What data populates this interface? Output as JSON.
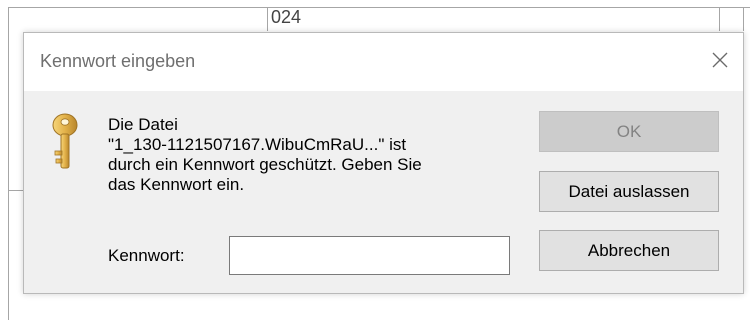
{
  "background_window": {
    "partial_text": "024"
  },
  "dialog": {
    "title": "Kennwort eingeben",
    "icon": "key-icon",
    "close_icon": "close-icon",
    "message_lines": [
      "Die Datei",
      "\"1_130-1121507167.WibuCmRaU...\" ist",
      "durch ein Kennwort geschützt. Geben Sie",
      "das Kennwort ein."
    ],
    "password_label": "Kennwort:",
    "password_value": "",
    "password_placeholder": "",
    "buttons": {
      "ok": {
        "label": "OK",
        "enabled": false
      },
      "skip": {
        "label": "Datei auslassen",
        "enabled": true
      },
      "cancel": {
        "label": "Abbrechen",
        "enabled": true
      }
    },
    "colors": {
      "dialog_bg": "#f0f0f0",
      "titlebar_bg": "#ffffff",
      "button_bg": "#e1e1e1",
      "button_disabled_bg": "#cccccc",
      "key_gold": "#e3b24a"
    }
  }
}
